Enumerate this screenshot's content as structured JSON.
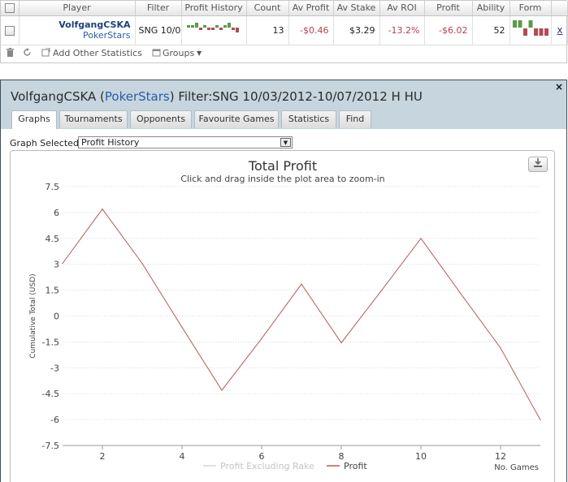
{
  "table": {
    "headers": [
      "",
      "Player",
      "Filter",
      "Profit History",
      "Count",
      "Av Profit",
      "Av Stake",
      "Av ROI",
      "Profit",
      "Ability",
      "Form",
      ""
    ],
    "row": {
      "player_name": "VolfgangCSKA",
      "player_site": "PokerStars",
      "filter": "SNG 10/0",
      "count": "13",
      "av_profit": "-$0.46",
      "av_stake": "$3.29",
      "av_roi": "-13.2%",
      "profit": "-$6.02",
      "ability": "52",
      "close": "x"
    },
    "profit_history_bars": [
      1,
      1,
      2,
      -1,
      1,
      -1,
      -1,
      1,
      -1,
      1,
      2,
      -1,
      -2
    ],
    "form_bars": [
      1,
      1,
      -1,
      1,
      -1,
      -1,
      -1
    ]
  },
  "toolbar": {
    "delete_icon": "trash-icon",
    "refresh_icon": "refresh-icon",
    "add_stats_label": "Add Other Statistics",
    "groups_label": "Groups"
  },
  "window": {
    "title_player": "VolfgangCSKA (",
    "title_site": "PokerStars",
    "title_rest": ") Filter:SNG 10/03/2012-10/07/2012 H HU",
    "close_label": "×"
  },
  "tabs": [
    "Graphs",
    "Tournaments",
    "Opponents",
    "Favourite Games",
    "Statistics",
    "Find"
  ],
  "graph_selected_label": "Graph Selected:",
  "graph_selected_value": "Profit History",
  "colors": {
    "profit_line": "#b55b5b",
    "rake_line": "#d6d6d6",
    "negative_text": "#b3414c",
    "bar_positive": "#5b9a4a",
    "bar_negative": "#b34a55",
    "header_bg": "#c6d5de"
  },
  "chart_data": {
    "type": "line",
    "title": "Total Profit",
    "subtitle": "Click and drag inside the plot area to zoom-in",
    "xlabel": "No. Games",
    "ylabel": "Cumulative Total (USD)",
    "ylim": [
      -7.5,
      7.5
    ],
    "xlim": [
      1,
      13
    ],
    "y_ticks": [
      "7.5",
      "6",
      "4.5",
      "3",
      "1.5",
      "0",
      "-1.5",
      "-3",
      "-4.5",
      "-6",
      "-7.5"
    ],
    "x_ticks": [
      "2",
      "4",
      "6",
      "8",
      "10",
      "12"
    ],
    "grid": true,
    "legend_position": "bottom",
    "series": [
      {
        "name": "Profit Excluding Rake",
        "x": [],
        "y": []
      },
      {
        "name": "Profit",
        "x": [
          1,
          2,
          3,
          4,
          5,
          6,
          7,
          8,
          9,
          10,
          11,
          12,
          13
        ],
        "y": [
          3.05,
          6.2,
          3.05,
          -0.65,
          -4.3,
          -1.3,
          1.85,
          -1.55,
          1.45,
          4.5,
          1.3,
          -1.85,
          -6.02
        ]
      }
    ]
  }
}
